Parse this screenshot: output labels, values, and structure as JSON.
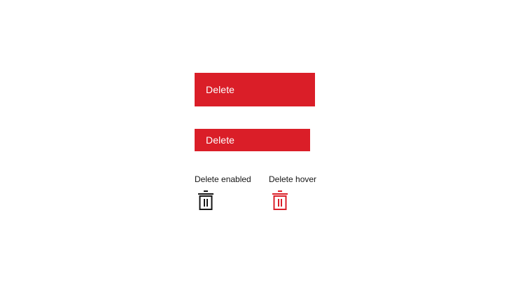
{
  "buttons": {
    "delete_large_label": "Delete",
    "delete_small_label": "Delete"
  },
  "captions": {
    "enabled": "Delete enabled",
    "hover": "Delete hover"
  },
  "icons": {
    "enabled": {
      "name": "trash-icon",
      "color": "#161616"
    },
    "hover": {
      "name": "trash-icon",
      "color": "#da1e28"
    }
  },
  "colors": {
    "danger": "#da1e28",
    "text_on_danger": "#ffffff",
    "text_primary": "#161616"
  }
}
